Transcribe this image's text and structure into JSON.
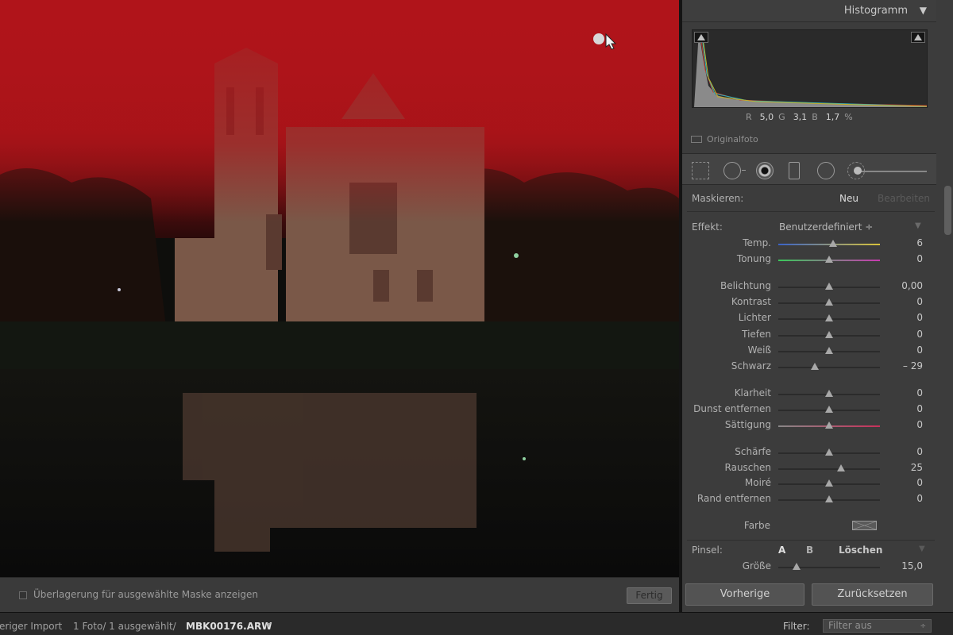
{
  "photo": {
    "overlay_label": "Überlagerung für ausgewählte Maske anzeigen",
    "done_label": "Fertig",
    "mask_color": "#b0141a"
  },
  "histogram": {
    "title": "Histogramm",
    "toggle": "▼",
    "r_label": "R",
    "r_value": "5,0",
    "g_label": "G",
    "g_value": "3,1",
    "b_label": "B",
    "b_value": "1,7",
    "unit": "%",
    "original_label": "Originalfoto"
  },
  "tools": [
    "crop-icon",
    "spot-removal-icon",
    "red-eye-icon",
    "graduated-filter-icon",
    "radial-filter-icon",
    "adjustment-brush-icon"
  ],
  "mask": {
    "label": "Maskieren:",
    "new_label": "Neu",
    "edit_label": "Bearbeiten"
  },
  "effect": {
    "label": "Effekt:",
    "value": "Benutzerdefiniert ÷",
    "arrow": "▼"
  },
  "sliders": [
    {
      "label": "Temp.",
      "value": "6",
      "pos": 0.54,
      "track": "temp"
    },
    {
      "label": "Tonung",
      "value": "0",
      "pos": 0.5,
      "track": "tint"
    },
    {
      "label": "Belichtung",
      "value": "0,00",
      "pos": 0.5
    },
    {
      "label": "Kontrast",
      "value": "0",
      "pos": 0.5
    },
    {
      "label": "Lichter",
      "value": "0",
      "pos": 0.5
    },
    {
      "label": "Tiefen",
      "value": "0",
      "pos": 0.5
    },
    {
      "label": "Weiß",
      "value": "0",
      "pos": 0.5
    },
    {
      "label": "Schwarz",
      "value": "– 29",
      "pos": 0.36
    },
    {
      "label": "Klarheit",
      "value": "0",
      "pos": 0.5
    },
    {
      "label": "Dunst entfernen",
      "value": "0",
      "pos": 0.5
    },
    {
      "label": "Sättigung",
      "value": "0",
      "pos": 0.5,
      "track": "sat"
    },
    {
      "label": "Schärfe",
      "value": "0",
      "pos": 0.5
    },
    {
      "label": "Rauschen",
      "value": "25",
      "pos": 0.62
    },
    {
      "label": "Moiré",
      "value": "0",
      "pos": 0.5
    },
    {
      "label": "Rand entfernen",
      "value": "0",
      "pos": 0.5
    }
  ],
  "color_label": "Farbe",
  "brush": {
    "label": "Pinsel:",
    "a": "A",
    "b": "B",
    "clear": "Löschen",
    "arrow": "▼",
    "size_label": "Größe",
    "size_value": "15,0",
    "size_pos": 0.18
  },
  "buttons": {
    "previous": "Vorherige",
    "reset": "Zurücksetzen"
  },
  "status": {
    "source": "eriger Import",
    "count": "1 Foto/  1 ausgewählt/",
    "file": "MBK00176.ARW",
    "file_arrow": "▾",
    "filter_label": "Filter:",
    "filter_value": "Filter aus",
    "filter_arrow": "÷"
  }
}
